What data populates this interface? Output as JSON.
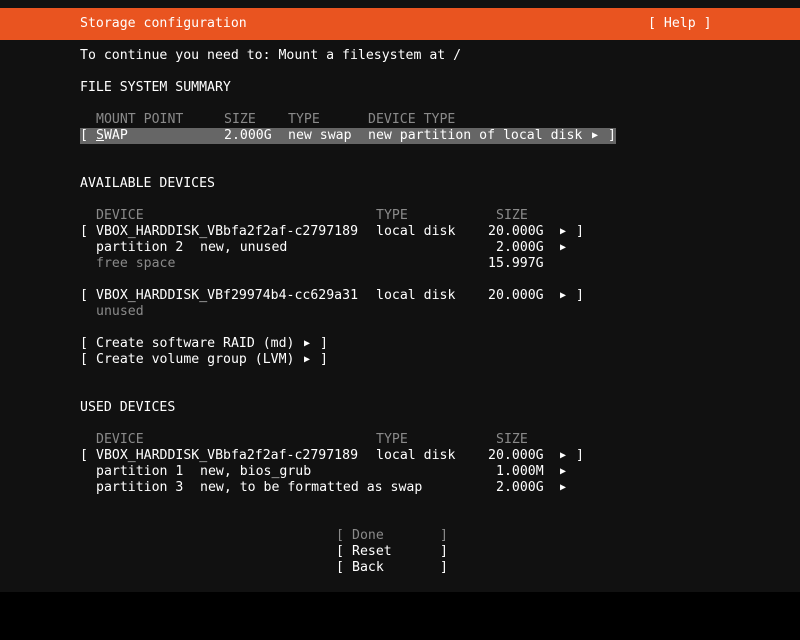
{
  "header": {
    "title": "Storage configuration",
    "help_label": "[ Help ]",
    "accent_color": "#E95420"
  },
  "prompt": "To continue you need to: Mount a filesystem at /",
  "fs_summary": {
    "heading": "FILE SYSTEM SUMMARY",
    "columns": [
      "MOUNT POINT",
      "SIZE",
      "TYPE",
      "DEVICE TYPE"
    ],
    "rows": [
      {
        "open": "[",
        "mount_first": "S",
        "mount_rest": "WAP",
        "size": "2.000G",
        "type": "new swap",
        "device_type": "new partition of local disk",
        "arrow": "▶",
        "close": "]"
      }
    ]
  },
  "available": {
    "heading": "AVAILABLE DEVICES",
    "columns": [
      "DEVICE",
      "TYPE",
      "SIZE"
    ],
    "disks": [
      {
        "name": "VBOX_HARDDISK_VBbfa2f2af-c2797189",
        "type": "local disk",
        "size": "20.000G",
        "children": [
          {
            "label": "partition 2",
            "desc": "new, unused",
            "size": "2.000G",
            "has_arrow": true
          },
          {
            "label": "free space",
            "desc": "",
            "size": "15.997G",
            "has_arrow": false
          }
        ]
      },
      {
        "name": "VBOX_HARDDISK_VBf29974b4-cc629a31",
        "type": "local disk",
        "size": "20.000G",
        "children": [
          {
            "label": "unused",
            "desc": "",
            "size": "",
            "has_arrow": false
          }
        ]
      }
    ],
    "actions": [
      "Create software RAID (md)",
      "Create volume group (LVM)"
    ]
  },
  "used": {
    "heading": "USED DEVICES",
    "columns": [
      "DEVICE",
      "TYPE",
      "SIZE"
    ],
    "disks": [
      {
        "name": "VBOX_HARDDISK_VBbfa2f2af-c2797189",
        "type": "local disk",
        "size": "20.000G",
        "children": [
          {
            "label": "partition 1",
            "desc": "new, bios_grub",
            "size": "1.000M"
          },
          {
            "label": "partition 3",
            "desc": "new, to be formatted as swap",
            "size": "2.000G"
          }
        ]
      }
    ]
  },
  "buttons": {
    "done": "Done",
    "reset": "Reset",
    "back": "Back"
  },
  "glyphs": {
    "arrow": "▶",
    "open": "[",
    "close": "]"
  }
}
